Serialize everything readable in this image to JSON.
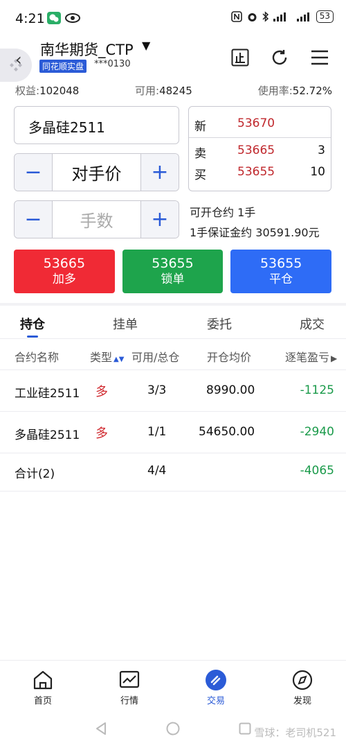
{
  "status": {
    "time": "4:21",
    "battery": "53"
  },
  "header": {
    "account_name": "南华期货_CTP",
    "badge": "同花顺实盘",
    "account_no": "***0130"
  },
  "equity": {
    "equity_label": "权益:",
    "equity_value": "102048",
    "avail_label": "可用:",
    "avail_value": "48245",
    "usage_label": "使用率:",
    "usage_value": "52.72%"
  },
  "order": {
    "contract": "多晶硅2511",
    "price_mode": "对手价",
    "qty_placeholder": "手数",
    "minus": "−",
    "plus": "+",
    "open_info": "可开仓约 1手",
    "margin_info": "1手保证金约 30591.90元"
  },
  "quote": {
    "last_label": "新",
    "last_price": "53670",
    "ask_label": "卖",
    "ask_price": "53665",
    "ask_vol": "3",
    "bid_label": "买",
    "bid_price": "53655",
    "bid_vol": "10"
  },
  "actions": [
    {
      "price": "53665",
      "label": "加多",
      "color": "#f02a35"
    },
    {
      "price": "53655",
      "label": "锁单",
      "color": "#1ea44c"
    },
    {
      "price": "53655",
      "label": "平仓",
      "color": "#2e6cf6"
    }
  ],
  "tabs": [
    "持仓",
    "挂单",
    "委托",
    "成交"
  ],
  "table": {
    "headers": [
      "合约名称",
      "类型",
      "可用/总仓",
      "开仓均价",
      "逐笔盈亏"
    ],
    "rows": [
      {
        "name": "工业硅2511",
        "type": "多",
        "qty": "3/3",
        "avg": "8990.00",
        "pnl": "-1125"
      },
      {
        "name": "多晶硅2511",
        "type": "多",
        "qty": "1/1",
        "avg": "54650.00",
        "pnl": "-2940"
      }
    ],
    "total": {
      "name": "合计(2)",
      "qty": "4/4",
      "pnl": "-4065"
    }
  },
  "nav": [
    "首页",
    "行情",
    "交易",
    "发现"
  ],
  "watermark": "雪球：老司机521",
  "colors": {
    "accent": "#2b5bd7",
    "up": "#c0282d",
    "down": "#1a9a4a"
  }
}
